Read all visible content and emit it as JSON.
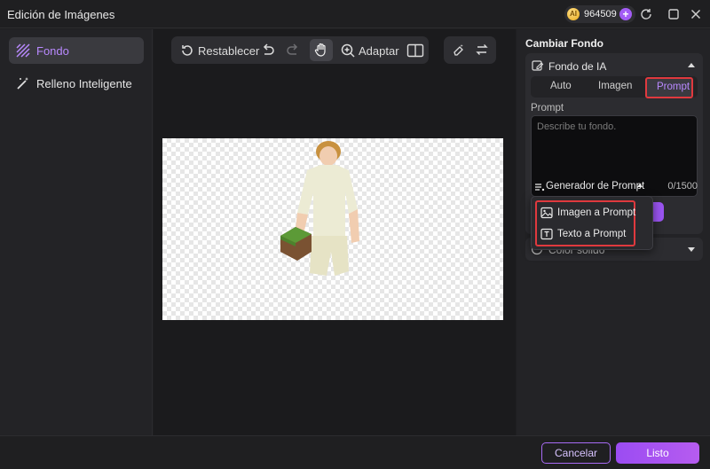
{
  "window": {
    "title": "Edición de Imágenes",
    "credits": "964509"
  },
  "sidebar": {
    "items": [
      {
        "label": "Fondo",
        "icon": "background-pattern-icon",
        "active": true
      },
      {
        "label": "Relleno Inteligente",
        "icon": "magic-wand-icon",
        "active": false
      }
    ]
  },
  "toolbar": {
    "reset_label": "Restablecer",
    "fit_label": "Adaptar"
  },
  "panel": {
    "title": "Cambiar Fondo",
    "ai_section": {
      "label": "Fondo de IA",
      "tabs": [
        "Auto",
        "Imagen",
        "Prompt"
      ],
      "selected_tab": "Prompt",
      "prompt_label": "Prompt",
      "placeholder": "Describe tu fondo.",
      "value": "",
      "generator_label": "Generador de Prompt",
      "counter": "0/1500"
    },
    "solid_section": {
      "label": "Color sólido"
    }
  },
  "dropdown": {
    "items": [
      {
        "label": "Imagen a Prompt",
        "icon": "image-icon"
      },
      {
        "label": "Texto a Prompt",
        "icon": "text-icon"
      }
    ]
  },
  "footer": {
    "cancel_label": "Cancelar",
    "ok_label": "Listo"
  },
  "colors": {
    "accent": "#a35cf5",
    "highlight_border": "#e0393e",
    "background": "#1f1f21"
  }
}
